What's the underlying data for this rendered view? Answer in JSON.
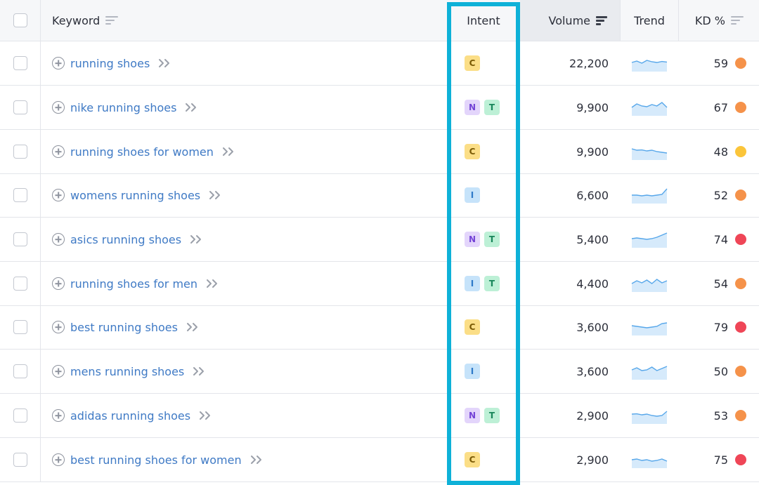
{
  "header": {
    "keyword": "Keyword",
    "intent": "Intent",
    "volume": "Volume",
    "trend": "Trend",
    "kd": "KD %"
  },
  "colors": {
    "kd_orange": "#f5924a",
    "kd_yellow": "#fbc53a",
    "kd_red": "#ef4657",
    "highlight": "#0eb1d8"
  },
  "rows": [
    {
      "keyword": "running shoes",
      "intents": [
        "C"
      ],
      "volume": "22,200",
      "trend": [
        0.55,
        0.65,
        0.5,
        0.7,
        0.6,
        0.55,
        0.62,
        0.58
      ],
      "kd": "59",
      "kd_level": "orange"
    },
    {
      "keyword": "nike running shoes",
      "intents": [
        "N",
        "T"
      ],
      "volume": "9,900",
      "trend": [
        0.5,
        0.75,
        0.6,
        0.55,
        0.7,
        0.6,
        0.85,
        0.5
      ],
      "kd": "67",
      "kd_level": "orange"
    },
    {
      "keyword": "running shoes for women",
      "intents": [
        "C"
      ],
      "volume": "9,900",
      "trend": [
        0.7,
        0.6,
        0.62,
        0.55,
        0.6,
        0.5,
        0.45,
        0.4
      ],
      "kd": "48",
      "kd_level": "yellow"
    },
    {
      "keyword": "womens running shoes",
      "intents": [
        "I"
      ],
      "volume": "6,600",
      "trend": [
        0.5,
        0.5,
        0.45,
        0.5,
        0.45,
        0.5,
        0.55,
        0.95
      ],
      "kd": "52",
      "kd_level": "orange"
    },
    {
      "keyword": "asics running shoes",
      "intents": [
        "N",
        "T"
      ],
      "volume": "5,400",
      "trend": [
        0.55,
        0.6,
        0.55,
        0.5,
        0.55,
        0.65,
        0.8,
        0.95
      ],
      "kd": "74",
      "kd_level": "red"
    },
    {
      "keyword": "running shoes for men",
      "intents": [
        "I",
        "T"
      ],
      "volume": "4,400",
      "trend": [
        0.5,
        0.7,
        0.55,
        0.75,
        0.5,
        0.8,
        0.55,
        0.7
      ],
      "kd": "54",
      "kd_level": "orange"
    },
    {
      "keyword": "best running shoes",
      "intents": [
        "C"
      ],
      "volume": "3,600",
      "trend": [
        0.6,
        0.55,
        0.5,
        0.45,
        0.5,
        0.55,
        0.75,
        0.8
      ],
      "kd": "79",
      "kd_level": "red"
    },
    {
      "keyword": "mens running shoes",
      "intents": [
        "I"
      ],
      "volume": "3,600",
      "trend": [
        0.6,
        0.75,
        0.55,
        0.6,
        0.8,
        0.55,
        0.7,
        0.85
      ],
      "kd": "50",
      "kd_level": "orange"
    },
    {
      "keyword": "adidas running shoes",
      "intents": [
        "N",
        "T"
      ],
      "volume": "2,900",
      "trend": [
        0.6,
        0.62,
        0.55,
        0.6,
        0.5,
        0.45,
        0.5,
        0.8
      ],
      "kd": "53",
      "kd_level": "orange"
    },
    {
      "keyword": "best running shoes for women",
      "intents": [
        "C"
      ],
      "volume": "2,900",
      "trend": [
        0.5,
        0.55,
        0.45,
        0.5,
        0.4,
        0.45,
        0.55,
        0.4
      ],
      "kd": "75",
      "kd_level": "red"
    }
  ]
}
